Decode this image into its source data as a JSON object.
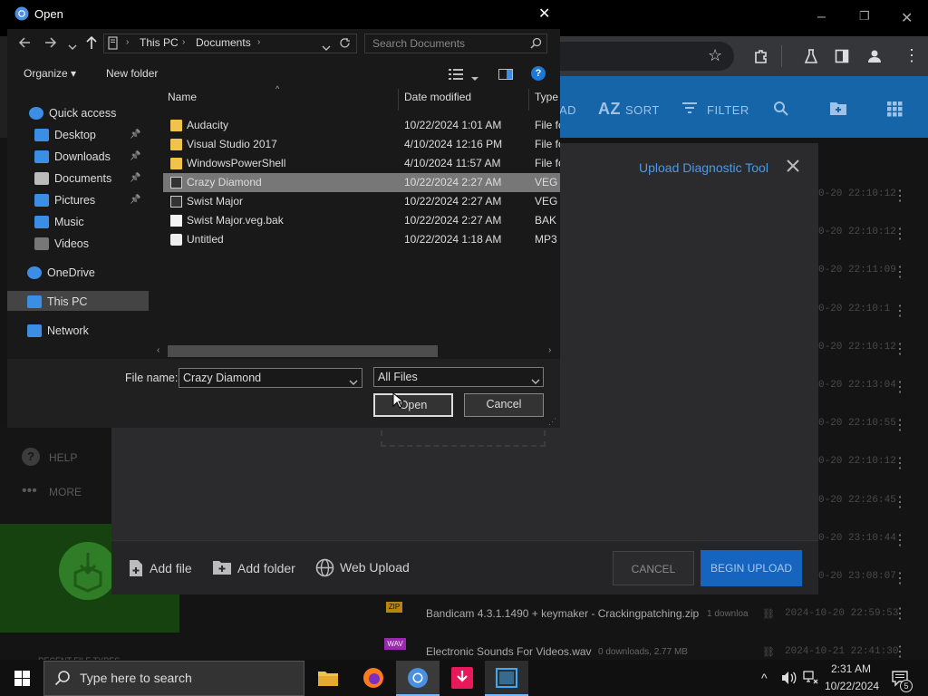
{
  "browser": {
    "window_controls": {
      "minimize": "–",
      "restore": "❐",
      "close": "✕"
    }
  },
  "web_app": {
    "header": {
      "sort_label": "SORT",
      "filter_label": "FILTER",
      "az_label": "AZ",
      "partial_label": "AD"
    },
    "nav": {
      "help_label": "HELP",
      "more_label": "MORE",
      "partial_bottom": "RECENT FILE TYPES"
    },
    "row_dates": [
      "0-20 22:10:12",
      "0-20 22:10:12",
      "0-20 22:11:09",
      "0-20 22:10:1",
      "0-20 22:10:12",
      "0-20 22:13:04",
      "0-20 22:10:55",
      "0-20 22:10:12",
      "0-20 22:26:45",
      "0-20 23:10:44",
      "0-20 23:08:07",
      "2024-10-20 22:59:53",
      "2024-10-21 22:41:30"
    ],
    "modal": {
      "title": "Upload Diagnostic Tool",
      "footer": {
        "add_file": "Add file",
        "add_folder": "Add folder",
        "web_upload": "Web Upload",
        "cancel": "CANCEL",
        "begin_upload": "BEGIN UPLOAD"
      }
    },
    "files_below": [
      {
        "badge": "ZIP",
        "badge_color": "#b8860b",
        "name": "Bandicam 4.3.1.1490 + keymaker - Crackingpatching.zip",
        "meta": "1 downloa"
      },
      {
        "badge": "WAV",
        "badge_color": "#9c27b0",
        "name": "Electronic Sounds For Videos.wav",
        "meta": "0 downloads, 2.77 MB"
      }
    ]
  },
  "dialog": {
    "title": "Open",
    "close": "✕",
    "breadcrumb": [
      "This PC",
      "Documents"
    ],
    "search_placeholder": "Search Documents",
    "organize": "Organize ▾",
    "new_folder": "New folder",
    "help": "?",
    "nav_items": [
      {
        "label": "Quick access",
        "icon": "star-icon",
        "color": "#3a8ee6"
      },
      {
        "label": "Desktop",
        "icon": "desktop-icon",
        "color": "#3a8ee6",
        "pinned": true
      },
      {
        "label": "Downloads",
        "icon": "download-icon",
        "color": "#3a8ee6",
        "pinned": true
      },
      {
        "label": "Documents",
        "icon": "documents-icon",
        "color": "#bbbbbb",
        "pinned": true
      },
      {
        "label": "Pictures",
        "icon": "pictures-icon",
        "color": "#3a8ee6",
        "pinned": true
      },
      {
        "label": "Music",
        "icon": "music-icon",
        "color": "#3a8ee6"
      },
      {
        "label": "Videos",
        "icon": "videos-icon",
        "color": "#777777"
      },
      {
        "label": "OneDrive",
        "icon": "cloud-icon",
        "color": "#3a8ee6"
      },
      {
        "label": "This PC",
        "icon": "pc-icon",
        "color": "#3a8ee6",
        "selected": true
      },
      {
        "label": "Network",
        "icon": "network-icon",
        "color": "#3a8ee6"
      }
    ],
    "columns": {
      "name": "Name",
      "date": "Date modified",
      "type": "Type"
    },
    "files": [
      {
        "name": "Audacity",
        "date": "10/22/2024 1:01 AM",
        "type": "File fo",
        "kind": "folder"
      },
      {
        "name": "Visual Studio 2017",
        "date": "4/10/2024 12:16 PM",
        "type": "File fo",
        "kind": "folder"
      },
      {
        "name": "WindowsPowerShell",
        "date": "4/10/2024 11:57 AM",
        "type": "File fo",
        "kind": "folder"
      },
      {
        "name": "Crazy Diamond",
        "date": "10/22/2024 2:27 AM",
        "type": "VEG F",
        "kind": "veg",
        "selected": true
      },
      {
        "name": "Swist Major",
        "date": "10/22/2024 2:27 AM",
        "type": "VEG F",
        "kind": "veg"
      },
      {
        "name": "Swist Major.veg.bak",
        "date": "10/22/2024 2:27 AM",
        "type": "BAK F",
        "kind": "blank"
      },
      {
        "name": "Untitled",
        "date": "10/22/2024 1:18 AM",
        "type": "MP3",
        "kind": "mp3"
      }
    ],
    "file_name_label": "File name:",
    "file_name_value": "Crazy Diamond",
    "file_type_value": "All Files",
    "open_button": "Open",
    "cancel_button": "Cancel"
  },
  "taskbar": {
    "search_placeholder": "Type here to search",
    "time": "2:31 AM",
    "date": "10/22/2024",
    "notification_count": "5"
  }
}
